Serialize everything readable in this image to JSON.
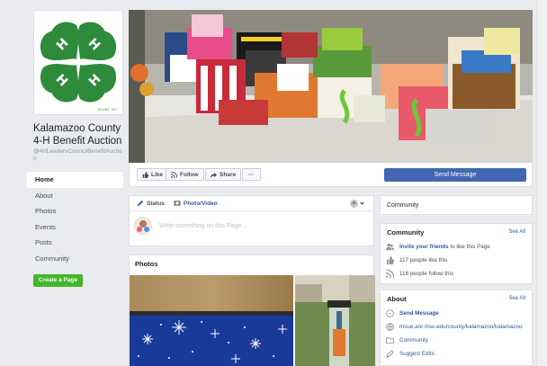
{
  "page": {
    "name": "Kalamazoo County 4-H Benefit Auction",
    "handle": "@4HLeadersCouncilBenefitAuction",
    "logo_caption": "18 USC 707"
  },
  "nav": [
    {
      "label": "Home",
      "active": true
    },
    {
      "label": "About"
    },
    {
      "label": "Photos"
    },
    {
      "label": "Events"
    },
    {
      "label": "Posts"
    },
    {
      "label": "Community"
    }
  ],
  "create_page_label": "Create a Page",
  "actions": {
    "like": "Like",
    "follow": "Follow",
    "share": "Share",
    "more": "···",
    "send_message": "Send Message"
  },
  "composer": {
    "status_tab": "Status",
    "photo_tab": "Photo/Video",
    "placeholder": "Write something on this Page..."
  },
  "photos_title": "Photos",
  "right": {
    "community_header": "Community",
    "community": {
      "title": "Community",
      "see_all": "See All",
      "invite_link": "Invite your friends",
      "invite_rest": " to like this Page",
      "likes": "117 people like this",
      "follows": "116 people follow this"
    },
    "about": {
      "title": "About",
      "see_all": "See All",
      "send_message": "Send Message",
      "website": "msue.anr.msu.edu/county/kalamazoo/kalamazoo",
      "category": "Community",
      "suggest": "Suggest Edits"
    }
  },
  "colors": {
    "brand_blue": "#4267b2",
    "link": "#365899",
    "green": "#42b72a",
    "clover": "#2e8b3c"
  }
}
